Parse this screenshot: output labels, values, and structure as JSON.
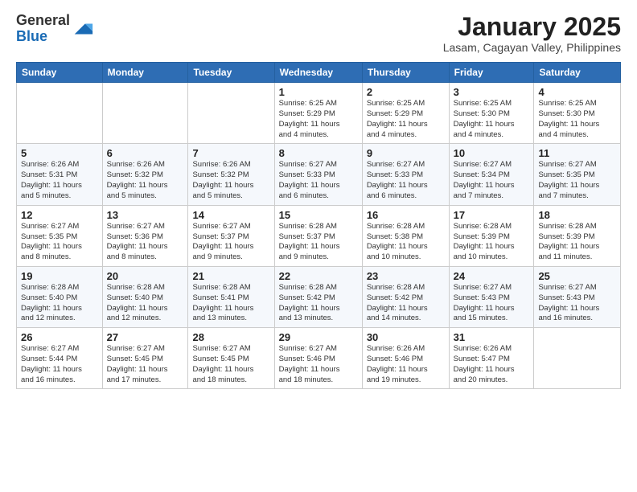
{
  "header": {
    "logo_general": "General",
    "logo_blue": "Blue",
    "month_title": "January 2025",
    "location": "Lasam, Cagayan Valley, Philippines"
  },
  "weekdays": [
    "Sunday",
    "Monday",
    "Tuesday",
    "Wednesday",
    "Thursday",
    "Friday",
    "Saturday"
  ],
  "weeks": [
    [
      {
        "day": "",
        "info": ""
      },
      {
        "day": "",
        "info": ""
      },
      {
        "day": "",
        "info": ""
      },
      {
        "day": "1",
        "info": "Sunrise: 6:25 AM\nSunset: 5:29 PM\nDaylight: 11 hours\nand 4 minutes."
      },
      {
        "day": "2",
        "info": "Sunrise: 6:25 AM\nSunset: 5:29 PM\nDaylight: 11 hours\nand 4 minutes."
      },
      {
        "day": "3",
        "info": "Sunrise: 6:25 AM\nSunset: 5:30 PM\nDaylight: 11 hours\nand 4 minutes."
      },
      {
        "day": "4",
        "info": "Sunrise: 6:25 AM\nSunset: 5:30 PM\nDaylight: 11 hours\nand 4 minutes."
      }
    ],
    [
      {
        "day": "5",
        "info": "Sunrise: 6:26 AM\nSunset: 5:31 PM\nDaylight: 11 hours\nand 5 minutes."
      },
      {
        "day": "6",
        "info": "Sunrise: 6:26 AM\nSunset: 5:32 PM\nDaylight: 11 hours\nand 5 minutes."
      },
      {
        "day": "7",
        "info": "Sunrise: 6:26 AM\nSunset: 5:32 PM\nDaylight: 11 hours\nand 5 minutes."
      },
      {
        "day": "8",
        "info": "Sunrise: 6:27 AM\nSunset: 5:33 PM\nDaylight: 11 hours\nand 6 minutes."
      },
      {
        "day": "9",
        "info": "Sunrise: 6:27 AM\nSunset: 5:33 PM\nDaylight: 11 hours\nand 6 minutes."
      },
      {
        "day": "10",
        "info": "Sunrise: 6:27 AM\nSunset: 5:34 PM\nDaylight: 11 hours\nand 7 minutes."
      },
      {
        "day": "11",
        "info": "Sunrise: 6:27 AM\nSunset: 5:35 PM\nDaylight: 11 hours\nand 7 minutes."
      }
    ],
    [
      {
        "day": "12",
        "info": "Sunrise: 6:27 AM\nSunset: 5:35 PM\nDaylight: 11 hours\nand 8 minutes."
      },
      {
        "day": "13",
        "info": "Sunrise: 6:27 AM\nSunset: 5:36 PM\nDaylight: 11 hours\nand 8 minutes."
      },
      {
        "day": "14",
        "info": "Sunrise: 6:27 AM\nSunset: 5:37 PM\nDaylight: 11 hours\nand 9 minutes."
      },
      {
        "day": "15",
        "info": "Sunrise: 6:28 AM\nSunset: 5:37 PM\nDaylight: 11 hours\nand 9 minutes."
      },
      {
        "day": "16",
        "info": "Sunrise: 6:28 AM\nSunset: 5:38 PM\nDaylight: 11 hours\nand 10 minutes."
      },
      {
        "day": "17",
        "info": "Sunrise: 6:28 AM\nSunset: 5:39 PM\nDaylight: 11 hours\nand 10 minutes."
      },
      {
        "day": "18",
        "info": "Sunrise: 6:28 AM\nSunset: 5:39 PM\nDaylight: 11 hours\nand 11 minutes."
      }
    ],
    [
      {
        "day": "19",
        "info": "Sunrise: 6:28 AM\nSunset: 5:40 PM\nDaylight: 11 hours\nand 12 minutes."
      },
      {
        "day": "20",
        "info": "Sunrise: 6:28 AM\nSunset: 5:40 PM\nDaylight: 11 hours\nand 12 minutes."
      },
      {
        "day": "21",
        "info": "Sunrise: 6:28 AM\nSunset: 5:41 PM\nDaylight: 11 hours\nand 13 minutes."
      },
      {
        "day": "22",
        "info": "Sunrise: 6:28 AM\nSunset: 5:42 PM\nDaylight: 11 hours\nand 13 minutes."
      },
      {
        "day": "23",
        "info": "Sunrise: 6:28 AM\nSunset: 5:42 PM\nDaylight: 11 hours\nand 14 minutes."
      },
      {
        "day": "24",
        "info": "Sunrise: 6:27 AM\nSunset: 5:43 PM\nDaylight: 11 hours\nand 15 minutes."
      },
      {
        "day": "25",
        "info": "Sunrise: 6:27 AM\nSunset: 5:43 PM\nDaylight: 11 hours\nand 16 minutes."
      }
    ],
    [
      {
        "day": "26",
        "info": "Sunrise: 6:27 AM\nSunset: 5:44 PM\nDaylight: 11 hours\nand 16 minutes."
      },
      {
        "day": "27",
        "info": "Sunrise: 6:27 AM\nSunset: 5:45 PM\nDaylight: 11 hours\nand 17 minutes."
      },
      {
        "day": "28",
        "info": "Sunrise: 6:27 AM\nSunset: 5:45 PM\nDaylight: 11 hours\nand 18 minutes."
      },
      {
        "day": "29",
        "info": "Sunrise: 6:27 AM\nSunset: 5:46 PM\nDaylight: 11 hours\nand 18 minutes."
      },
      {
        "day": "30",
        "info": "Sunrise: 6:26 AM\nSunset: 5:46 PM\nDaylight: 11 hours\nand 19 minutes."
      },
      {
        "day": "31",
        "info": "Sunrise: 6:26 AM\nSunset: 5:47 PM\nDaylight: 11 hours\nand 20 minutes."
      },
      {
        "day": "",
        "info": ""
      }
    ]
  ]
}
